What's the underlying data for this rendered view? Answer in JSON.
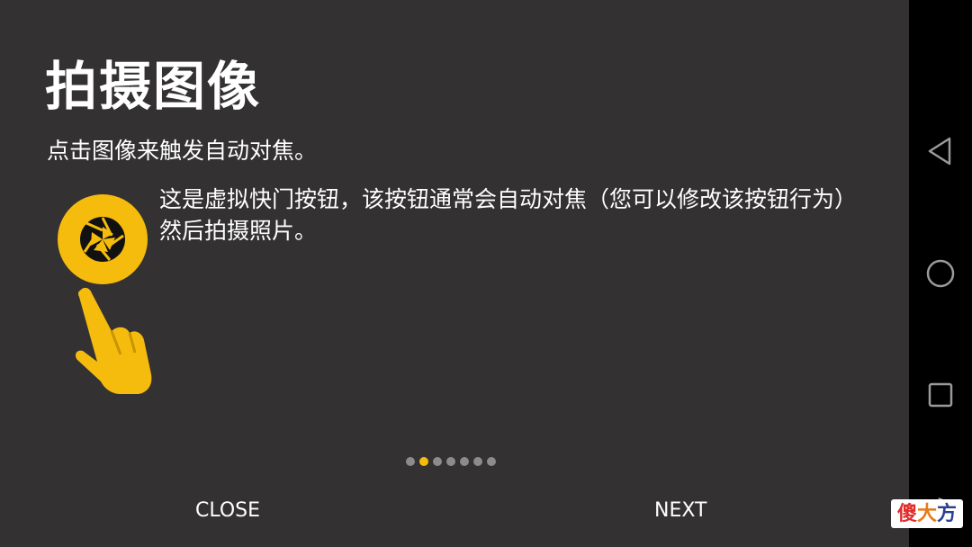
{
  "tutorial": {
    "title": "拍摄图像",
    "subtitle": "点击图像来触发自动对焦。",
    "description": "这是虚拟快门按钮，该按钮通常会自动对焦（您可以修改该按钮行为）然后拍摄照片。",
    "shutter_icon": "camera-aperture-icon",
    "hand_icon": "pointing-hand-icon",
    "accent_color": "#f5bc0e",
    "background_color": "#333132",
    "page_count": 7,
    "current_page": 2,
    "close_label": "CLOSE",
    "next_label": "NEXT"
  },
  "navigation_bar": {
    "back_icon": "triangle-back-icon",
    "home_icon": "circle-home-icon",
    "recent_icon": "square-recents-icon",
    "extra_glyph": ">"
  },
  "watermark": {
    "text": "傻大方"
  }
}
